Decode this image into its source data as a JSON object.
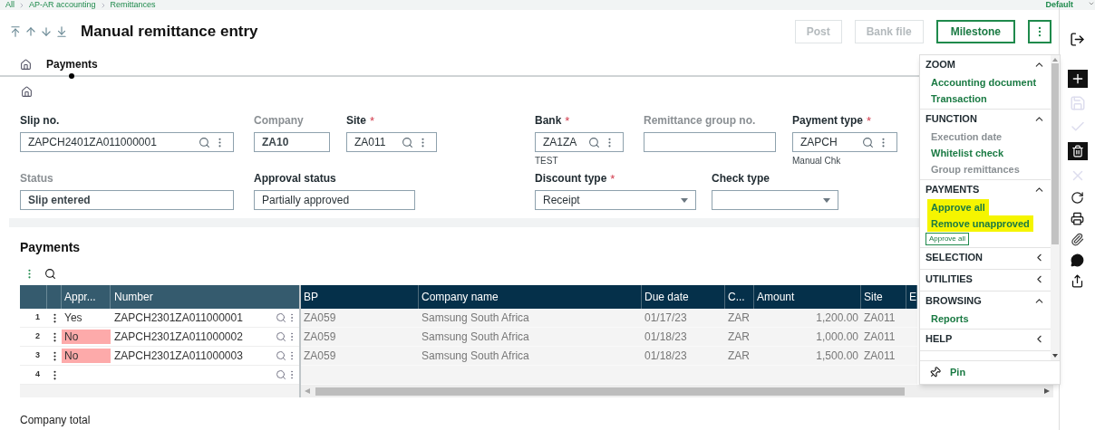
{
  "breadcrumb": {
    "items": [
      "All",
      "AP-AR accounting",
      "Remittances"
    ],
    "profile": "Default"
  },
  "title": "Manual remittance entry",
  "actions": [
    {
      "label": "Post",
      "disabled": true
    },
    {
      "label": "Bank file",
      "disabled": true
    },
    {
      "label": "Milestone",
      "disabled": false
    }
  ],
  "tabs": [
    {
      "label": "Payments",
      "selected": true
    }
  ],
  "form": {
    "fields": [
      {
        "label": "Slip no.",
        "disabled": false,
        "kind": "lookup",
        "value": "ZAPCH2401ZA011000001"
      },
      {
        "label": "Company",
        "disabled": true,
        "kind": "text",
        "value": "ZA10"
      },
      {
        "label": "Site",
        "required_mark": "*",
        "disabled": false,
        "kind": "lookup",
        "value": "ZA011"
      },
      {
        "label": "Bank",
        "required_mark": "*",
        "disabled": false,
        "kind": "lookup",
        "value": "ZA1ZA",
        "subtext": "TEST"
      },
      {
        "label": "Remittance group no.",
        "disabled": true,
        "kind": "text"
      },
      {
        "label": "Payment type",
        "required_mark": "*",
        "disabled": false,
        "kind": "lookup",
        "value": "ZAPCH",
        "subtext": "Manual Chk"
      },
      {
        "label": "Status",
        "disabled": true,
        "kind": "text",
        "value": "Slip entered"
      },
      {
        "label": "Approval status",
        "disabled": false,
        "kind": "text",
        "value": "Partially approved"
      },
      {
        "label": "Discount type",
        "required_mark": "*",
        "disabled": false,
        "kind": "select",
        "value": "Receipt"
      },
      {
        "label": "Check type",
        "disabled": false,
        "kind": "select"
      }
    ]
  },
  "payments": {
    "title": "Payments",
    "frozen_columns": [
      "Appr...",
      "Number"
    ],
    "columns": [
      "BP",
      "Company name",
      "Due date",
      "C...",
      "Amount",
      "Site",
      "E"
    ],
    "rows": [
      {
        "row": "1",
        "appr": "Yes",
        "approved": true,
        "number": "ZAPCH2301ZA011000001",
        "cells": [
          "ZA059",
          "Samsung South Africa",
          "01/17/23",
          "ZAR",
          "1,200.00",
          "ZA011"
        ]
      },
      {
        "row": "2",
        "appr": "No",
        "approved": false,
        "number": "ZAPCH2301ZA011000002",
        "cells": [
          "ZA059",
          "Samsung South Africa",
          "01/18/23",
          "ZAR",
          "1,000.00",
          "ZA011"
        ]
      },
      {
        "row": "3",
        "appr": "No",
        "approved": false,
        "number": "ZAPCH2301ZA011000003",
        "cells": [
          "ZA059",
          "Samsung South Africa",
          "01/18/23",
          "ZAR",
          "1,500.00",
          "ZA011"
        ]
      },
      {
        "row": "4"
      }
    ]
  },
  "footer_label": "Company total",
  "menu": {
    "sections": [
      {
        "title": "ZOOM",
        "expanded": true,
        "items": [
          {
            "label": "Accounting document",
            "disabled": false,
            "highlighted": false
          },
          {
            "label": "Transaction",
            "disabled": false,
            "highlighted": false
          }
        ]
      },
      {
        "title": "FUNCTION",
        "expanded": true,
        "items": [
          {
            "label": "Execution date",
            "disabled": true,
            "highlighted": false
          },
          {
            "label": "Whitelist check",
            "disabled": false,
            "highlighted": false
          },
          {
            "label": "Group remittances",
            "disabled": true,
            "highlighted": false
          }
        ]
      },
      {
        "title": "PAYMENTS",
        "expanded": true,
        "items": [
          {
            "label": "Approve all",
            "disabled": false,
            "highlighted": true
          },
          {
            "label": "Remove unapproved",
            "disabled": false,
            "highlighted": true
          }
        ],
        "tooltip": "Approve all"
      },
      {
        "title": "SELECTION",
        "expanded": false
      },
      {
        "title": "UTILITIES",
        "expanded": false
      },
      {
        "title": "BROWSING",
        "expanded": true,
        "items": [
          {
            "label": "Reports",
            "disabled": false,
            "highlighted": false
          }
        ]
      },
      {
        "title": "HELP",
        "expanded": false
      }
    ],
    "pin": "Pin"
  }
}
